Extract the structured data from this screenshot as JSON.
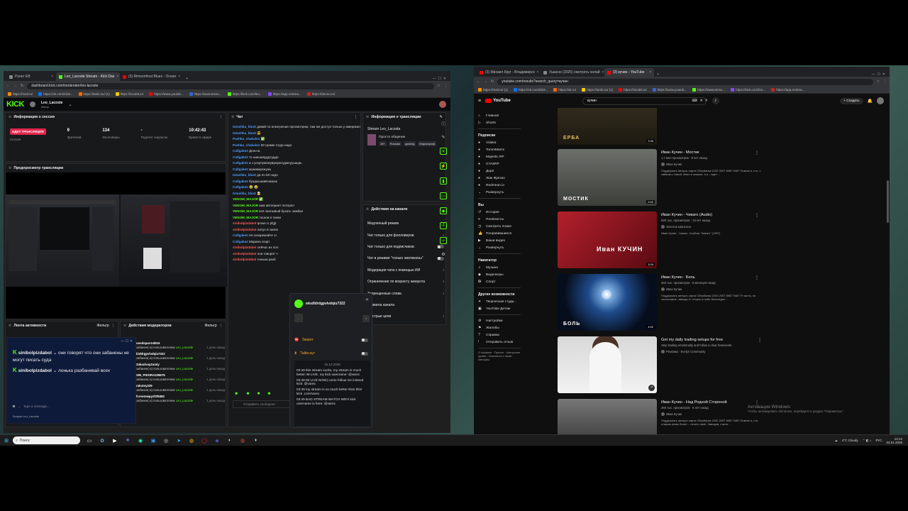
{
  "kick_window": {
    "tabs": [
      {
        "label": "Рунет ЕВ",
        "color": "#888"
      },
      {
        "label": "Leo_Lacoste Stream - Kick Das",
        "color": "#53fc18"
      },
      {
        "label": "(3) Rimsonfrost Blues - Ocean",
        "color": "#ff0000"
      }
    ],
    "url": "dashboard.kick.com/moderator/leo-lacoste",
    "bookmarks": [
      "https://mail.ru/",
      "https://vk.com/id19...",
      "https://tanki.su/ (1)",
      "https://locobit.io/",
      "https://www.youtub...",
      "https://www.tensu...",
      "https://kick.com/leo...",
      "https://app.restrea...",
      "https://donnu.ru/"
    ],
    "logo": "KICK",
    "user": {
      "name": "Leo_Lacoste",
      "role": "Автор"
    },
    "session": {
      "title": "Информация о сессии",
      "live_badge": "ИДЕТ ТРАНСЛЯЦИЯ",
      "live_sub": "Сессия",
      "viewers": "9",
      "viewers_label": "Зрителей",
      "followers": "134",
      "followers_label": "Фолловеры",
      "subs": "-",
      "subs_label": "Подсчет подписок",
      "time": "10:42:43",
      "time_label": "Время в эфире"
    },
    "preview_title": "Предпросмотр трансляции",
    "activity": {
      "title": "Лента активности",
      "filter": "Фильтр"
    },
    "mod_actions": {
      "title": "Действия модераторов",
      "filter": "Фильтр",
      "rows": [
        {
          "name": "onedsparrnd915",
          "text": "пользователем",
          "by": "Leo_Lacoste",
          "time": "1 день назад"
        },
        {
          "name": "biddrgpvlvdqiu7322",
          "text": "пользователем",
          "by": "Leo_Lacoste",
          "time": "1 день назад"
        },
        {
          "name": "ZakazivayZamiy",
          "text": "пользователем",
          "by": "Leo_Lacoste",
          "time": "1 день назад"
        },
        {
          "name": "SIN_PIDORA228675",
          "text": "пользователем",
          "by": "Leo_Lacoste",
          "time": "1 день назад"
        },
        {
          "name": "rakutoy229",
          "text": "пользователем",
          "by": "Leo_Lacoste",
          "time": "1 день назад"
        },
        {
          "name": "fcreotowpyzf2f8482",
          "text": "пользователем",
          "by": "Leo_Lacoste",
          "time": "1 день назад"
        }
      ]
    },
    "popup_chat": {
      "lines": [
        {
          "name": "sinibolpizdabol",
          "text": "они говорят что они забанены не могут писать суда"
        },
        {
          "name": "sinibolpizdabol",
          "text": "лонька разбанивай всех"
        }
      ],
      "placeholder": "Type a message...",
      "footer_user": "Богдан Leo_Lacoste"
    },
    "chat": {
      "title": "Чат",
      "lines": [
        {
          "name": "tutushka_blunt",
          "color": "#4e9cff",
          "text": "давай по алкогрение просмотрим, там же доступ только у американской Таня есть"
        },
        {
          "name": "tutushka_blunt",
          "color": "#4e9cff",
          "text": "😎"
        },
        {
          "name": "Pashka_chakalov",
          "color": "#4e9cff",
          "text": "✅"
        },
        {
          "name": "Pashka_chakalov",
          "color": "#4e9cff",
          "text": "50 грамм тогда надо"
        },
        {
          "name": "Cullgake2",
          "color": "#4e9cff",
          "text": "Дольча"
        },
        {
          "name": "Cullgake2",
          "color": "#4e9cff",
          "text": "то шишшвуддтуддо"
        },
        {
          "name": "Cullgake2",
          "color": "#4e9cff",
          "text": "а з ускупуможувумуюгудмнуушщиь"
        },
        {
          "name": "Cullgake2",
          "color": "#4e9cff",
          "text": "мужжмужжужь"
        },
        {
          "name": "tutushka_blunt",
          "color": "#4e9cff",
          "text": "да по 50 надо"
        },
        {
          "name": "Cullgake2",
          "color": "#4e9cff",
          "text": "бущвышиивтакжак"
        },
        {
          "name": "Cullgake2",
          "color": "#4e9cff",
          "text": "😂 😂"
        },
        {
          "name": "tutushka_blunt",
          "color": "#4e9cff",
          "text": "🍺"
        },
        {
          "name": "VENOM_MAJOR",
          "color": "#53fc18",
          "text": "✅"
        },
        {
          "name": "VENOM_MAJOR",
          "color": "#53fc18",
          "text": "вам автоприет потерял"
        },
        {
          "name": "VENOM_MAJOR",
          "color": "#53fc18",
          "text": "всё заплывый бухать замбал"
        },
        {
          "name": "VENOM_MAJOR",
          "color": "#53fc18",
          "text": "пошли в танки"
        },
        {
          "name": "sinibolpizdabol",
          "color": "#ff5a5a",
          "text": "qmwx ci pfgjt"
        },
        {
          "name": "sinibolpizdabol",
          "color": "#ff5a5a",
          "text": "латун в запое"
        },
        {
          "name": "Cullgake2",
          "color": "#4e9cff",
          "text": "Не кхкарежайте зт"
        },
        {
          "name": "Cullgake2",
          "color": "#4e9cff",
          "text": "Марина скарт"
        },
        {
          "name": "sinibolpizdabol",
          "color": "#ff5a5a",
          "text": "сейчас их пол"
        },
        {
          "name": "sinibolpizdabol",
          "color": "#ff5a5a",
          "text": "они говорят ч"
        },
        {
          "name": "sinibolpizdabol",
          "color": "#ff5a5a",
          "text": "лонька разб"
        }
      ],
      "send_placeholder": "Отправить сообщени"
    },
    "stream_info": {
      "title": "Информация о трансляции",
      "stream_name": "Stream Leo_Lacosta",
      "category": "Просто общение",
      "tags": [
        "18+",
        "Russian",
        "gaming",
        "Мариограф"
      ]
    },
    "channel_actions": {
      "title": "Действия на канале",
      "items": [
        {
          "label": "Медленный режим",
          "kind": "chevron"
        },
        {
          "label": "Чат только для фолловеров",
          "kind": "chevron"
        },
        {
          "label": "Чат только для подписчиков",
          "kind": "toggle"
        },
        {
          "label": "Чат в режиме \"только эмотиконы\"",
          "kind": "toggle"
        },
        {
          "label": "Модерация чата с помощью ИИ",
          "kind": "chevron"
        },
        {
          "label": "Ограничение по возрасту аккаунта",
          "kind": "chevron"
        },
        {
          "label": "Запрещенные слова",
          "kind": "chevron"
        },
        {
          "label": "Правила канала",
          "kind": "none"
        },
        {
          "label": "Быстрые цели",
          "kind": "chevron"
        }
      ]
    },
    "user_card": {
      "username": "wiudldrdgpvlvdqiu7322",
      "ban_label": "Запрет",
      "timeout_label": "Тайм-аут",
      "date": "21.12.2025",
      "messages": [
        "03:49 this stream sucks, my stream is much better IM LIVE. my kick username: @varec",
        "03:49 IM LIVE NOW) come follow me insteed kick: @varec",
        "03:49 my stream is so much better than this! kick .com/varec",
        "03:49 BAD STREAM WATCH Ml!!!!! kick username is here: @varec"
      ]
    }
  },
  "yt_window": {
    "tabs": [
      {
        "label": "(3) Михаил Круг - Владимирск",
        "color": "#ff0000"
      },
      {
        "label": "Ушасно (2025) смотреть онлай",
        "color": "#888"
      },
      {
        "label": "(3) кучин - YouTube",
        "color": "#ff0000"
      }
    ],
    "url": "youtube.com/results?search_query=кучин",
    "bookmarks": [
      "https://mail.ru/ (1)",
      "https://vk.com/id19...",
      "https://ok.ru/",
      "https://tanki.su/ (1)",
      "https://locobit.io/",
      "https://www.youtub...",
      "https://www.tensu...",
      "https://kick.com/leo...",
      "https://app.restrea..."
    ],
    "logo": "YouTube",
    "search_value": "кучин",
    "create_label": "Создать",
    "sidebar": {
      "main": [
        "Главная",
        "Shorts"
      ],
      "subs_title": "Подписки",
      "subs": [
        "Volaka",
        "TommMamc",
        "Majestic RP",
        "GTA5RP",
        "Дорл",
        "Жак Фреско",
        "Redmean.io",
        "Развернуть"
      ],
      "you_title": "Вы",
      "you": [
        "История",
        "Плейлисты",
        "Смотреть позже",
        "Понравившиеся",
        "Ваши видео",
        "Развернуть"
      ],
      "nav_title": "Навигатор",
      "nav": [
        "Музыка",
        "Видеоигры",
        "Спорт"
      ],
      "more_title": "Другие возможности",
      "more": [
        "Творческая студи...",
        "YouTube Детям"
      ],
      "settings": [
        "Настройки",
        "Жалобы",
        "Справка",
        "Отправить отзыв"
      ],
      "footer": "О сервисе · Прессе · Авторские права · Связаться с нами · Авторам"
    },
    "videos": [
      {
        "title": "",
        "meta": "1 млн просмотров · 8 лет назад",
        "channel": "Иван Кучин",
        "desc": "",
        "duration": "3:36",
        "thumb_text": "ЕРБА"
      },
      {
        "title": "Иван Кучин - Мостик",
        "meta": "1,7 млн просмотров · 8 лет назад",
        "channel": "Иван Кучин",
        "desc": "Поддержать автора: карта Сбербанка 2202 2007 8987 9487 Помню я, сто, с чайком и тьмой. Мать в окошке, а я – едет ...",
        "duration": "2:52",
        "thumb_text": "МОСТИК"
      },
      {
        "title": "Иван Кучин - Чикаго (Audio)",
        "meta": "825 тыс. просмотров · 13 лет назад",
        "channel": "Золотое Шансона",
        "desc": "Иван Кучин - Чикаго. Альбом \"Чикаго\" (1997)",
        "duration": "3:39",
        "thumb_text": "Иван КУЧИН"
      },
      {
        "title": "Иван Кучин - Боль",
        "meta": "294 тыс. просмотров · 8 месяцев назад",
        "channel": "Иван Кучин",
        "desc": "Поддержать автора: карта Сбербанка 2202 2007 8987 9487 Я чисты, но холостамое: заводы И, стерли в себе бесследно ...",
        "duration": "4:52",
        "thumb_text": "БОЛЬ"
      },
      {
        "title": "Get my daily trading setups for free",
        "meta": "Stop trading emotionally and follow a clear framework",
        "channel": "Реклама · Evelyn Community",
        "desc": "",
        "duration": "",
        "thumb_text": ""
      },
      {
        "title": "Иван Кучин - Над Родной Стороной",
        "meta": "393 тыс. просмотров · 6 лет назад",
        "channel": "Иван Кучин",
        "desc": "Поддержать автора: карта Сбербанка 2202 2007 8987 9487 Помню я, сто, старым ремы болит – нечего своё. Заводов, стала ...",
        "duration": "",
        "thumb_text": ""
      }
    ],
    "watermark": {
      "line1": "Активация Windows",
      "line2": "Чтобы активировать Windows, перейдите в раздел \"Параметры\"."
    }
  },
  "taskbar": {
    "search": "Поиск",
    "weather": "4°C Cloudy",
    "lang": "РУС",
    "time": "13:12",
    "date": "02.01.2026"
  },
  "colors": {
    "kick_green": "#53fc18",
    "yt_red": "#ff0000",
    "live_red": "#e2264d"
  }
}
